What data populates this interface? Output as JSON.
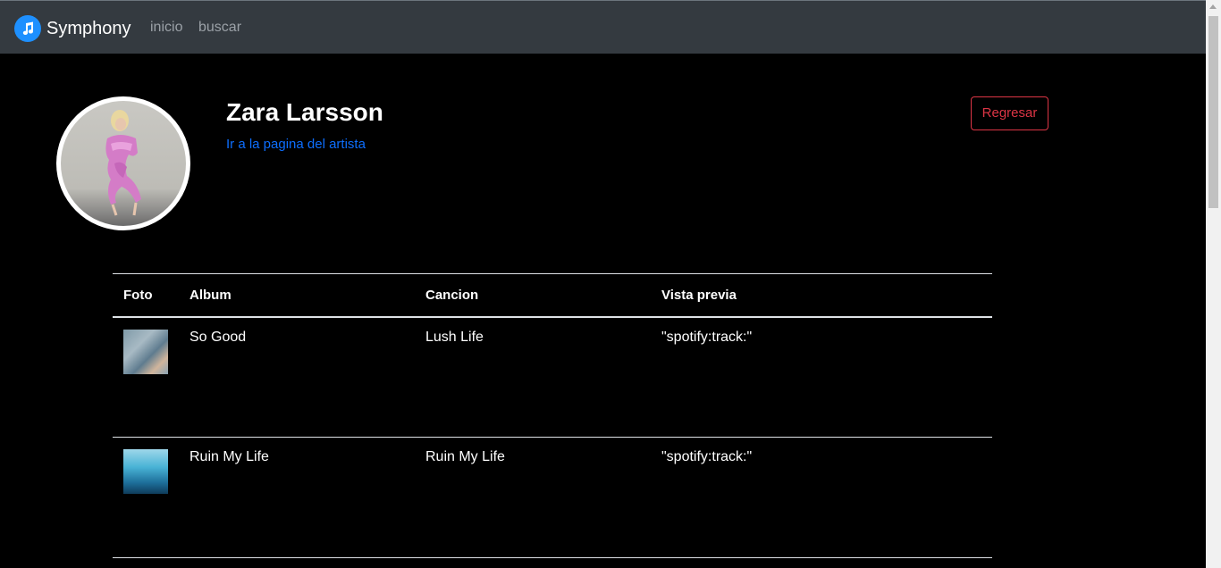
{
  "navbar": {
    "brand_name": "Symphony",
    "brand_icon": "music-note-icon",
    "links": [
      "inicio",
      "buscar"
    ]
  },
  "artist": {
    "name": "Zara Larsson",
    "link_text": "Ir a la pagina del artista",
    "back_label": "Regresar"
  },
  "table": {
    "headers": [
      "Foto",
      "Album",
      "Cancion",
      "Vista previa"
    ],
    "rows": [
      {
        "album": "So Good",
        "song": "Lush Life",
        "preview": "\"spotify:track:\""
      },
      {
        "album": "Ruin My Life",
        "song": "Ruin My Life",
        "preview": "\"spotify:track:\""
      }
    ]
  },
  "colors": {
    "navbar_bg": "#343a40",
    "link_blue": "#0d6efd",
    "danger_red": "#dc3545",
    "brand_blue": "#1e90ff"
  }
}
